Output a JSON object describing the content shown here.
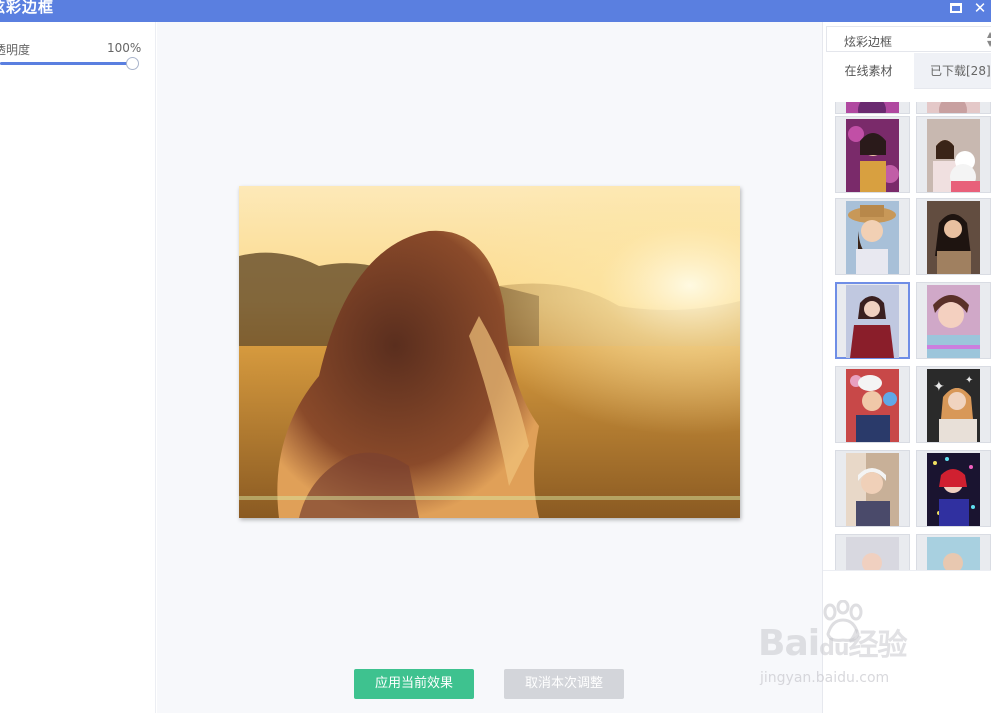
{
  "window": {
    "title": "炫彩边框",
    "maximize_icon": "maximize-icon",
    "close_icon": "close-icon",
    "close_glyph": "✕"
  },
  "left_panel": {
    "opacity_label": "透明度",
    "opacity_value": "100%",
    "opacity_level": 1.0
  },
  "canvas": {
    "apply_label": "应用当前效果",
    "cancel_label": "取消本次调整"
  },
  "right_panel": {
    "dropdown_value": "炫彩边框",
    "dropdown_arrows": "▲▼",
    "tabs": [
      {
        "label": "在线素材",
        "active": true
      },
      {
        "label": "已下载[28]",
        "active": false
      }
    ],
    "selected_thumb_index": 4
  },
  "watermark": {
    "brand": "Bai",
    "brand_mid": "du",
    "brand_cn": "经验",
    "url": "jingyan.baidu.com"
  },
  "colors": {
    "title_bar": "#5a7fe0",
    "apply_button": "#3ec28f",
    "cancel_button": "#d3d5da",
    "selection": "#6f8ee6"
  }
}
